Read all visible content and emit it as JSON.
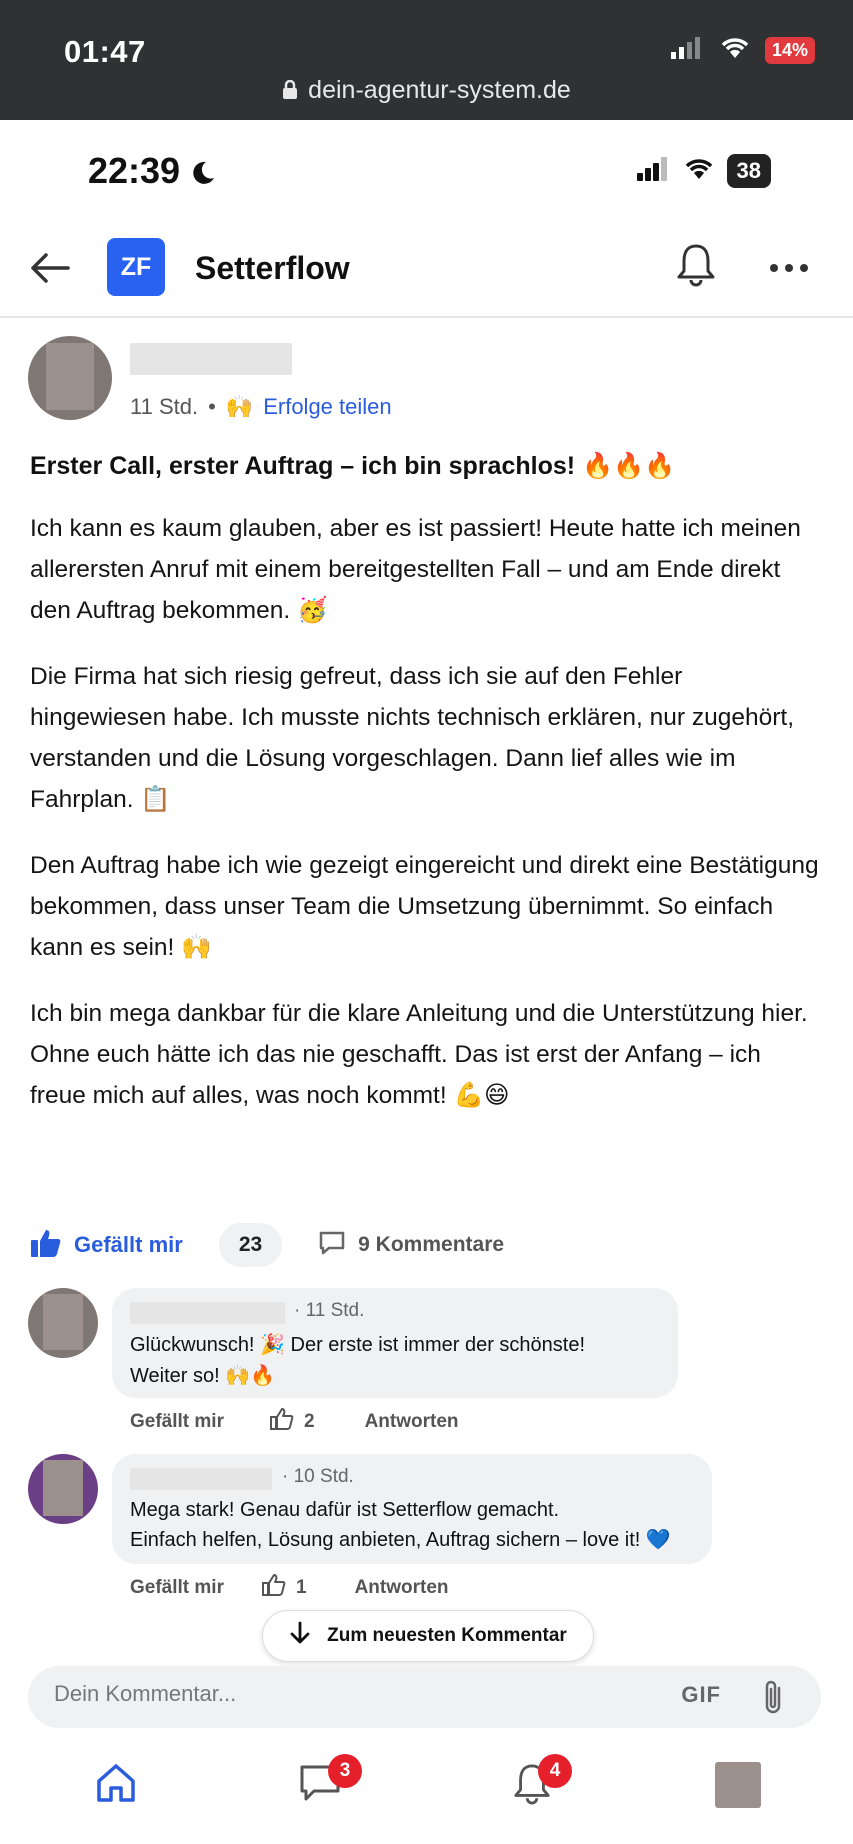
{
  "outer_status": {
    "time": "01:47",
    "url": "dein-agentur-system.de",
    "battery": "14%"
  },
  "inner_status": {
    "time": "22:39",
    "battery": "38"
  },
  "header": {
    "logo_text": "ZF",
    "title": "Setterflow"
  },
  "post": {
    "time": "11 Std.",
    "separator": "•",
    "category_emoji": "🙌",
    "category": "Erfolge teilen",
    "title": "Erster Call, erster Auftrag – ich bin sprachlos! 🔥🔥🔥",
    "paragraphs": [
      "Ich kann es kaum glauben, aber es ist passiert! Heute hatte ich meinen allerersten Anruf mit einem bereitgestellten Fall – und am Ende direkt den Auftrag bekommen. 🥳",
      "Die Firma hat sich riesig gefreut, dass ich sie auf den Fehler hingewiesen habe. Ich musste nichts technisch erklären, nur zugehört, verstanden und die Lösung vorgeschlagen. Dann lief alles wie im Fahrplan. 📋",
      "Den Auftrag habe ich wie gezeigt eingereicht und direkt eine Bestätigung bekommen, dass unser Team die Umsetzung übernimmt. So einfach kann es sein! 🙌",
      "Ich bin mega dankbar für die klare Anleitung und die Unterstützung hier. Ohne euch hätte ich das nie geschafft. Das ist erst der Anfang – ich freue mich auf alles, was noch kommt! 💪😄"
    ],
    "like_label": "Gefällt mir",
    "like_count": "23",
    "comments_label": "9 Kommentare"
  },
  "comments": [
    {
      "time": "· 11 Std.",
      "line1": "Glückwunsch! 🎉 Der erste ist immer der schönste!",
      "line2": "Weiter so! 🙌🔥",
      "like_label": "Gefällt mir",
      "like_count": "2",
      "reply_label": "Antworten"
    },
    {
      "time": "· 10 Std.",
      "line1": "Mega stark! Genau dafür ist Setterflow gemacht.",
      "line2": "Einfach helfen, Lösung anbieten, Auftrag sichern – love it! 💙",
      "like_label": "Gefällt mir",
      "like_count": "1",
      "reply_label": "Antworten"
    }
  ],
  "newest_button": "Zum neuesten Kommentar",
  "composer": {
    "placeholder": "Dein Kommentar...",
    "gif_label": "GIF"
  },
  "nav": {
    "messages_badge": "3",
    "notifications_badge": "4"
  },
  "colors": {
    "accent": "#2a5cde",
    "logo": "#2962f0",
    "badge": "#e5202b"
  }
}
